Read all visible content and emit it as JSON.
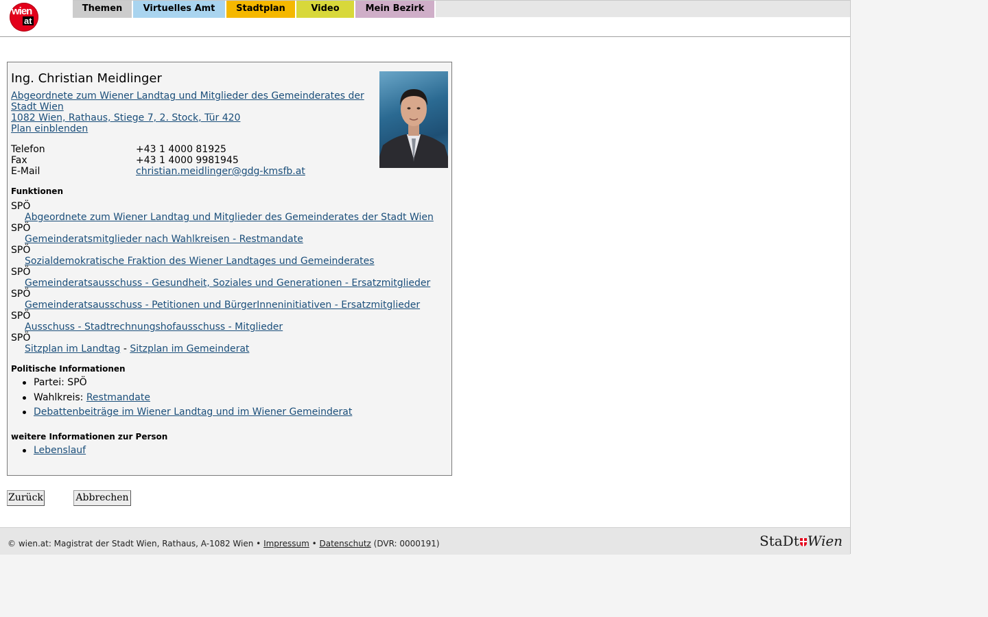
{
  "nav": {
    "logo_text_top": "wien",
    "logo_text_bottom": "at",
    "tabs": [
      {
        "label": "Themen",
        "color": "#cccccc"
      },
      {
        "label": "Virtuelles Amt",
        "color": "#a9d4ef"
      },
      {
        "label": "Stadtplan",
        "color": "#f5b800"
      },
      {
        "label": "Video",
        "color": "#d8d83a"
      },
      {
        "label": "Mein Bezirk",
        "color": "#cfaec8"
      }
    ]
  },
  "person": {
    "name": "Ing. Christian Meidlinger",
    "role_line1": "Abgeordnete zum Wiener Landtag und Mitglieder des Gemeinderates der",
    "role_line2": "Stadt Wien ",
    "address": "1082 Wien, Rathaus, Stiege 7, 2. Stock, Tür 420",
    "plan_link": "Plan einblenden",
    "contact": {
      "phone_label": "Telefon",
      "phone_value": "+43 1 4000 81925",
      "fax_label": "Fax",
      "fax_value": "+43 1 4000 9981945",
      "email_label": "E-Mail",
      "email_value": "christian.meidlinger@gdg-kmsfb.at"
    }
  },
  "functions": {
    "heading": "Funktionen",
    "items": [
      {
        "party": "SPÖ",
        "link": "Abgeordnete zum Wiener Landtag und Mitglieder des Gemeinderates der Stadt Wien"
      },
      {
        "party": "SPÖ",
        "link": "Gemeinderatsmitglieder nach Wahlkreisen - Restmandate"
      },
      {
        "party": "SPÖ",
        "link": "Sozialdemokratische Fraktion des Wiener Landtages und Gemeinderates"
      },
      {
        "party": "SPÖ",
        "link": "Gemeinderatsausschuss - Gesundheit, Soziales und Generationen - Ersatzmitglieder"
      },
      {
        "party": "SPÖ",
        "link": "Gemeinderatsausschuss - Petitionen und BürgerInneninitiativen - Ersatzmitglieder"
      },
      {
        "party": "SPÖ",
        "link": "Ausschuss - Stadtrechnungshofausschuss - Mitglieder"
      }
    ],
    "last_party": "SPÖ",
    "sitzplan_landtag": "Sitzplan im Landtag",
    "sitzplan_separator": " - ",
    "sitzplan_gemeinderat": "Sitzplan im Gemeinderat"
  },
  "political": {
    "heading": "Politische Informationen",
    "party_label": "Partei: SPÖ",
    "wahlkreis_label": "Wahlkreis: ",
    "wahlkreis_link": "Restmandate",
    "debatten_link": "Debattenbeiträge im Wiener Landtag und im Wiener Gemeinderat"
  },
  "further": {
    "heading": "weitere Informationen zur Person",
    "lebenslauf_link": "Lebenslauf"
  },
  "buttons": {
    "back": "Zurück",
    "cancel": "Abbrechen"
  },
  "footer": {
    "copyright": "© wien.at: Magistrat der Stadt Wien, Rathaus, A-1082 Wien • ",
    "impressum": "Impressum",
    "bullet": " • ",
    "datenschutz": "Datenschutz",
    "dvr": " (DVR: 0000191)",
    "stadt_logo_left": "StaDt",
    "stadt_logo_right": "Wien"
  }
}
